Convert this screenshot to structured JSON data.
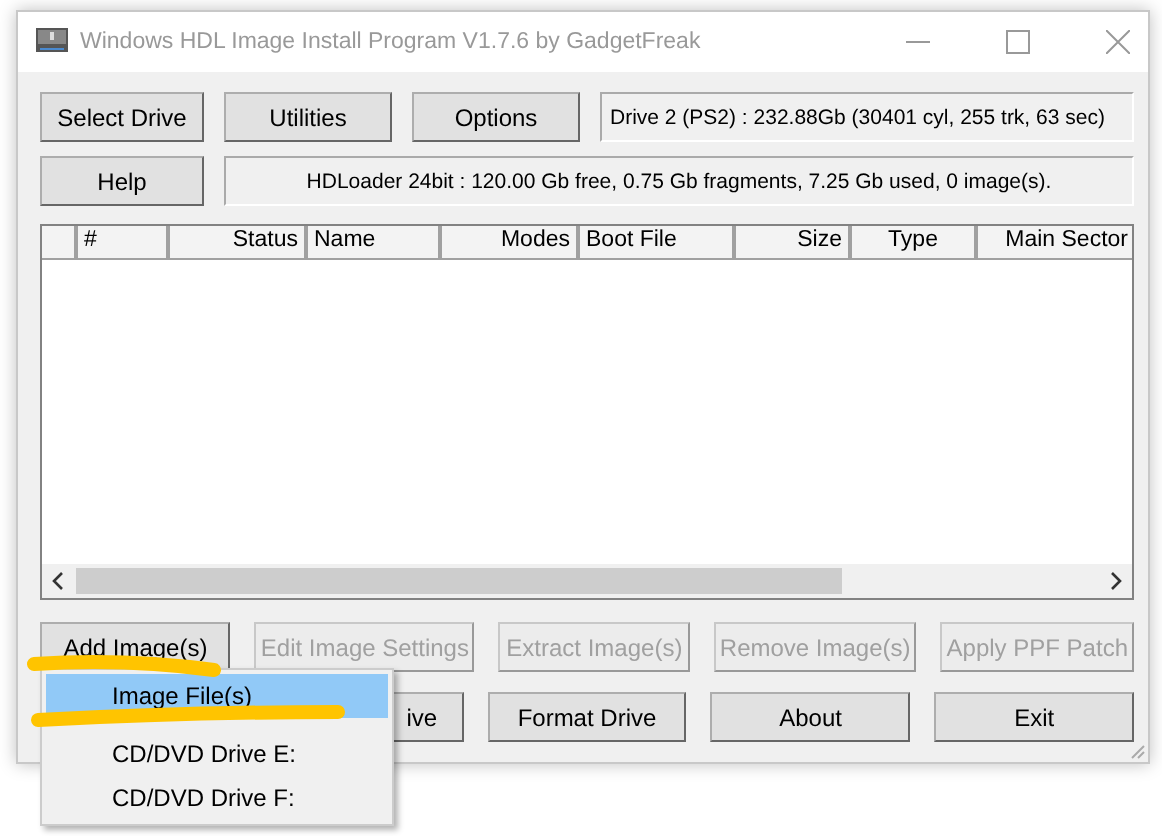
{
  "window": {
    "title": "Windows HDL Image Install Program V1.7.6 by GadgetFreak"
  },
  "top_buttons": [
    {
      "label": "Select Drive"
    },
    {
      "label": "Utilities"
    },
    {
      "label": "Options"
    }
  ],
  "drive_info": "Drive 2 (PS2) :  232.88Gb  (30401 cyl, 255 trk, 63 sec)",
  "help_button": {
    "label": "Help"
  },
  "hdd_info": "HDLoader 24bit :  120.00 Gb free,  0.75 Gb fragments,  7.25 Gb used,  0 image(s).",
  "table": {
    "columns": [
      {
        "label": "#"
      },
      {
        "label": "Status"
      },
      {
        "label": "Name"
      },
      {
        "label": "Modes"
      },
      {
        "label": "Boot File"
      },
      {
        "label": "Size"
      },
      {
        "label": "Type"
      },
      {
        "label": "Main Sector"
      }
    ]
  },
  "action_buttons": [
    {
      "label": "Add Image(s)",
      "disabled": false
    },
    {
      "label": "Edit Image Settings",
      "disabled": true
    },
    {
      "label": "Extract Image(s)",
      "disabled": true
    },
    {
      "label": "Remove Image(s)",
      "disabled": true
    },
    {
      "label": "Apply PPF Patch",
      "disabled": true
    }
  ],
  "lower_buttons": [
    {
      "label": "ive",
      "disabled": false
    },
    {
      "label": "Format Drive",
      "disabled": false
    },
    {
      "label": "About",
      "disabled": false
    },
    {
      "label": "Exit",
      "disabled": false
    }
  ],
  "menu": {
    "items": [
      {
        "label": "Image File(s)",
        "selected": true
      },
      {
        "label": "CD/DVD Drive E:",
        "selected": false
      },
      {
        "label": "CD/DVD Drive F:",
        "selected": false
      }
    ]
  }
}
